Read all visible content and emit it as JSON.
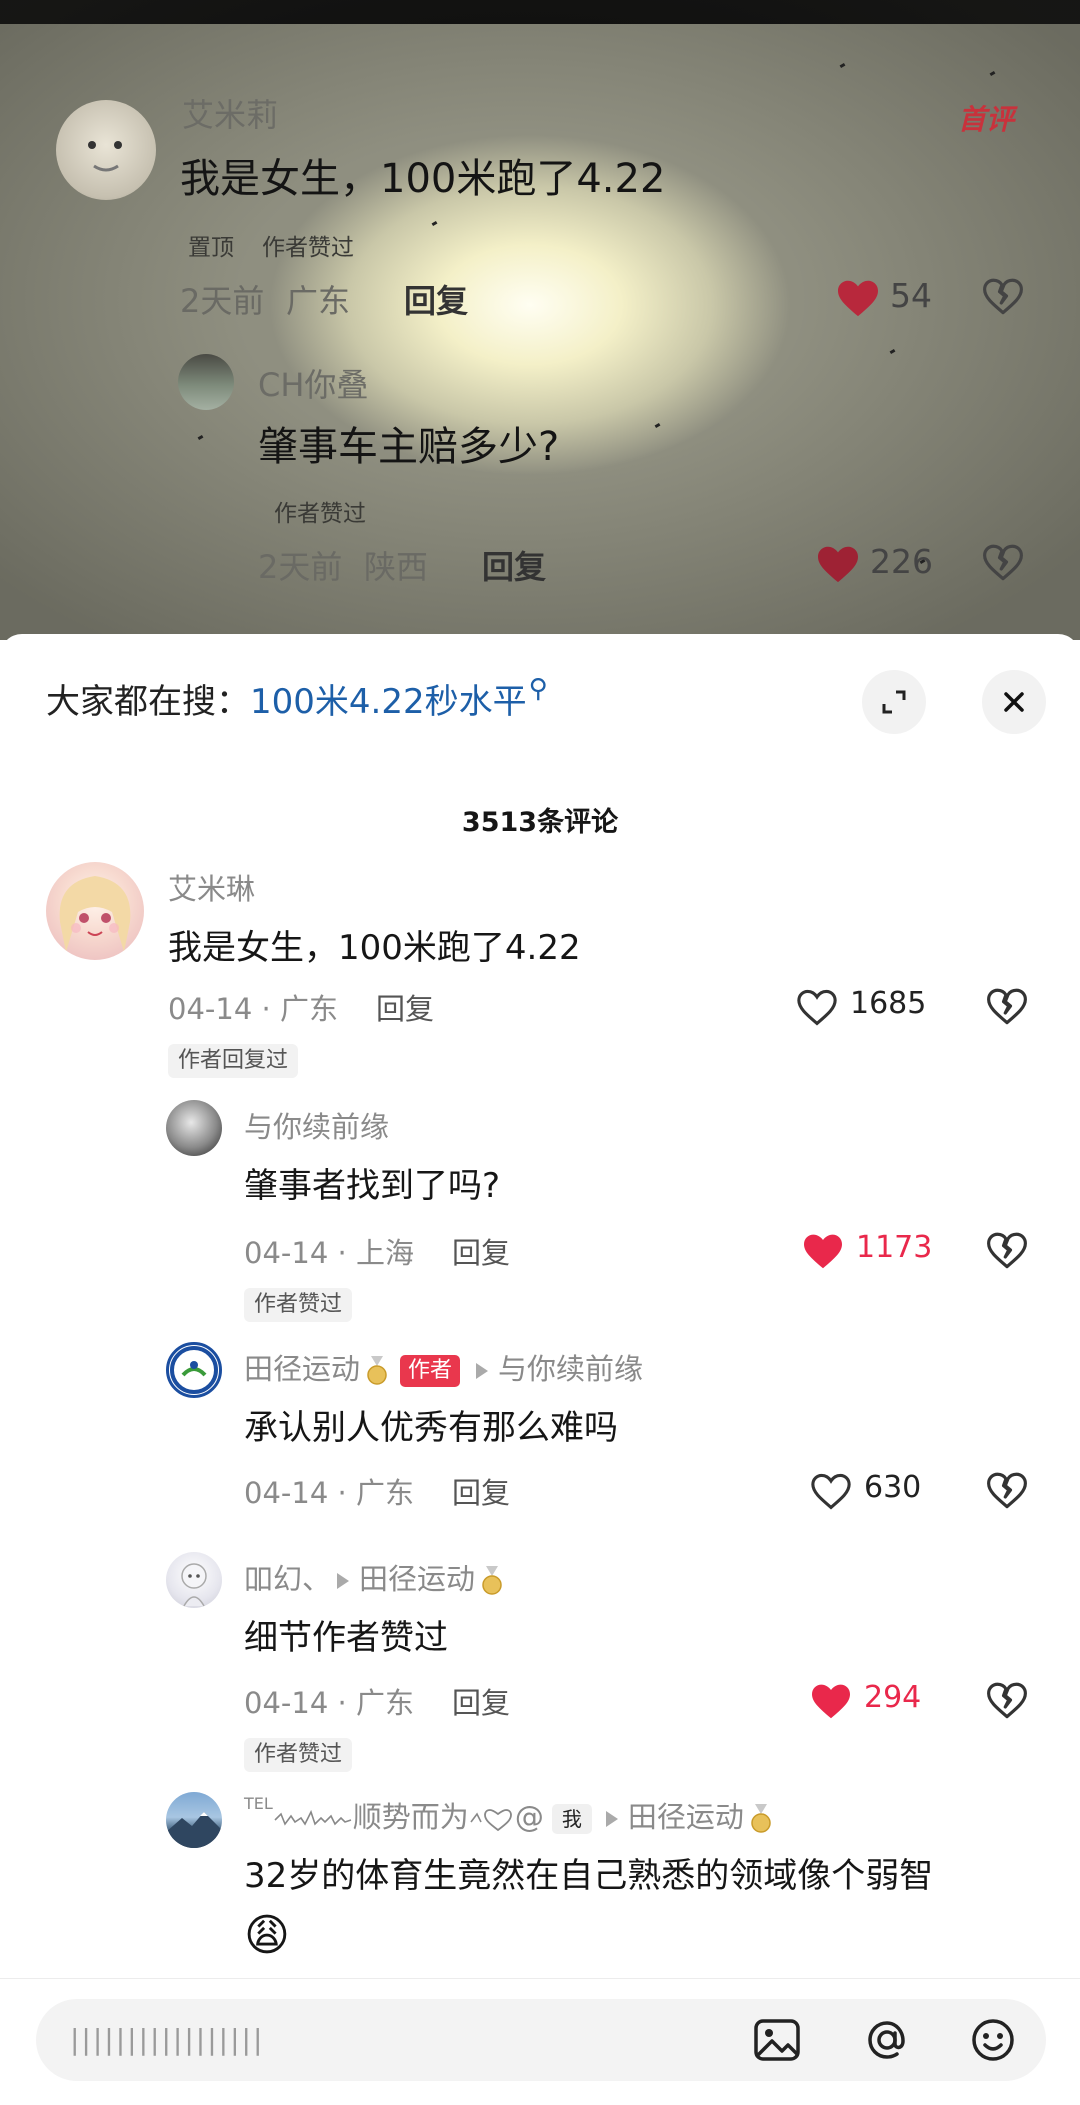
{
  "photo": {
    "comments": [
      {
        "username": "艾米莉",
        "text": "我是女生，100米跑了4.22",
        "tags": [
          "置顶",
          "作者赞过"
        ],
        "time": "2天前",
        "location": "广东",
        "reply": "回复",
        "likes": "54",
        "badge": "首评"
      },
      {
        "username": "CH你叠",
        "text": "肇事车主赔多少?",
        "tags": [
          "作者赞过"
        ],
        "time": "2天前",
        "location": "陕西",
        "reply": "回复",
        "likes": "226"
      }
    ]
  },
  "search": {
    "prefix": "大家都在搜：",
    "query": "100米4.22秒水平"
  },
  "header": {
    "title": "3513条评论"
  },
  "comments": [
    {
      "username": "艾米琳",
      "text": "我是女生，100米跑了4.22",
      "date": "04-14",
      "location": "广东",
      "reply": "回复",
      "likes": "1685",
      "liked": false,
      "tag": "作者回复过"
    },
    {
      "username": "与你续前缘",
      "text": "肇事者找到了吗?",
      "date": "04-14",
      "location": "上海",
      "reply": "回复",
      "likes": "1173",
      "liked": true,
      "tag": "作者赞过"
    },
    {
      "username": "田径运动",
      "author_badge": "作者",
      "reply_to": "与你续前缘",
      "text": "承认别人优秀有那么难吗",
      "date": "04-14",
      "location": "广东",
      "reply": "回复",
      "likes": "630",
      "liked": false
    },
    {
      "username": "吅幻、",
      "reply_to": "田径运动",
      "text": "细节作者赞过",
      "date": "04-14",
      "location": "广东",
      "reply": "回复",
      "likes": "294",
      "liked": true,
      "tag": "作者赞过"
    },
    {
      "username_prefix": "TEL",
      "username": "顺势而为",
      "username_suffix": "@",
      "me_badge": "我",
      "reply_to": "田径运动",
      "text": "32岁的体育生竟然在自己熟悉的领域像个弱智",
      "emoji": "😩"
    }
  ],
  "separator": "·",
  "bottom_bar": {
    "input_placeholder": "|||||||||||||||||",
    "icons": [
      "image-icon",
      "at-icon",
      "emoji-icon"
    ]
  },
  "colors": {
    "like_red": "#e9284b",
    "link_blue": "#1d5fa8",
    "author_badge": "#e9374d"
  }
}
